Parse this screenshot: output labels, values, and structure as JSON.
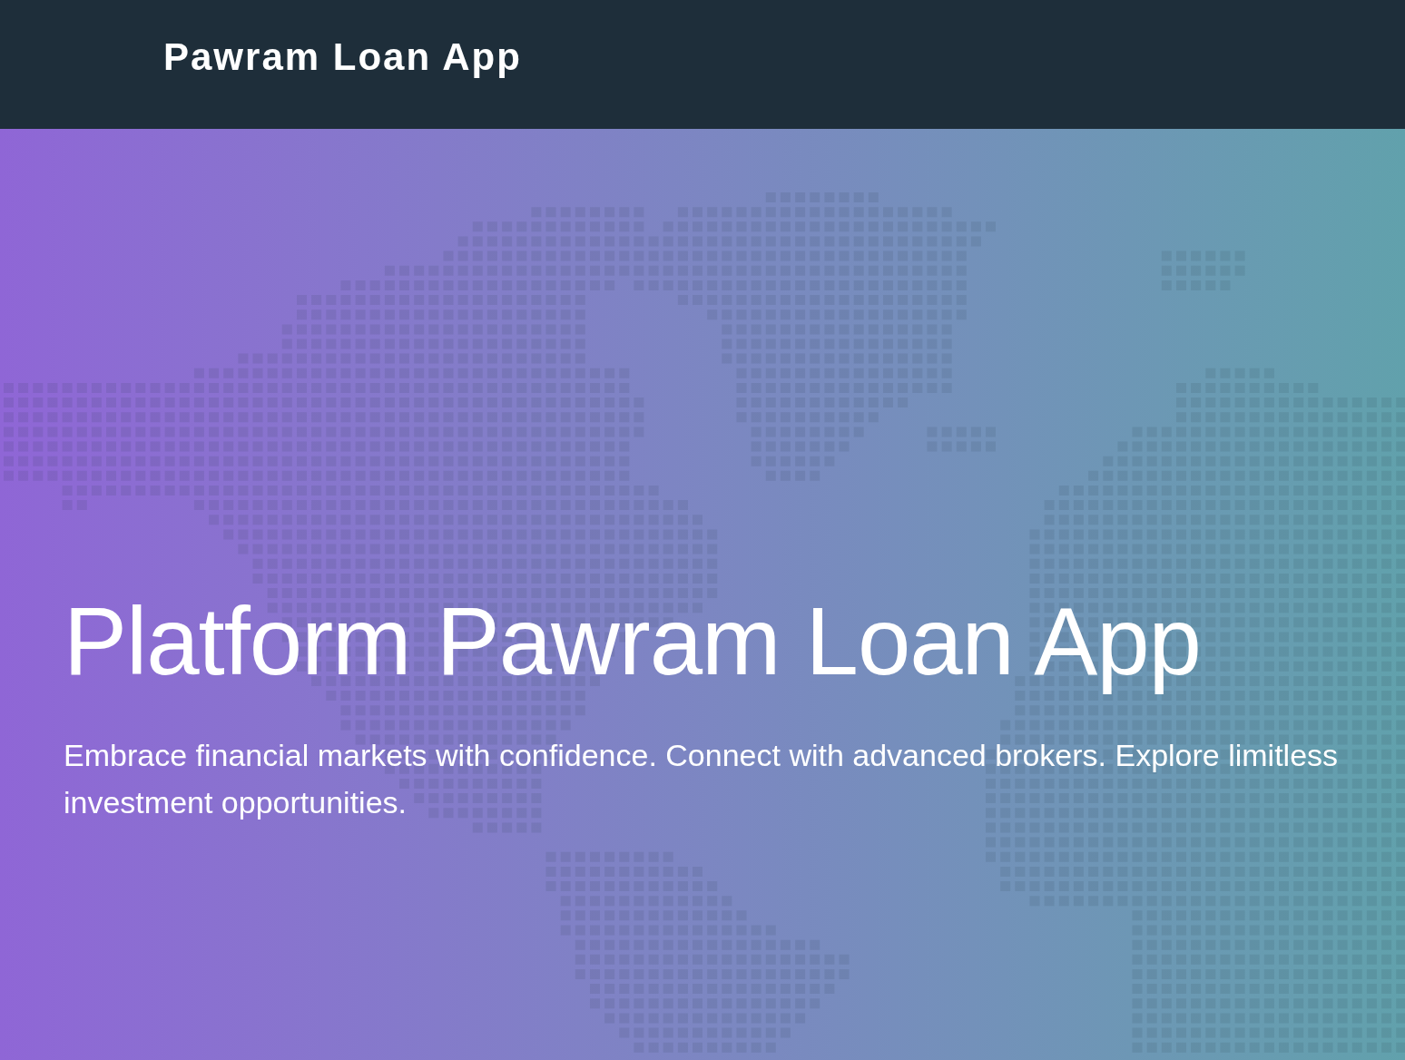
{
  "header": {
    "brand": "Pawram Loan App"
  },
  "hero": {
    "title": "Platform Pawram Loan App",
    "subtitle": "Embrace financial markets with confidence. Connect with advanced brokers. Explore limitless investment opportunities."
  }
}
